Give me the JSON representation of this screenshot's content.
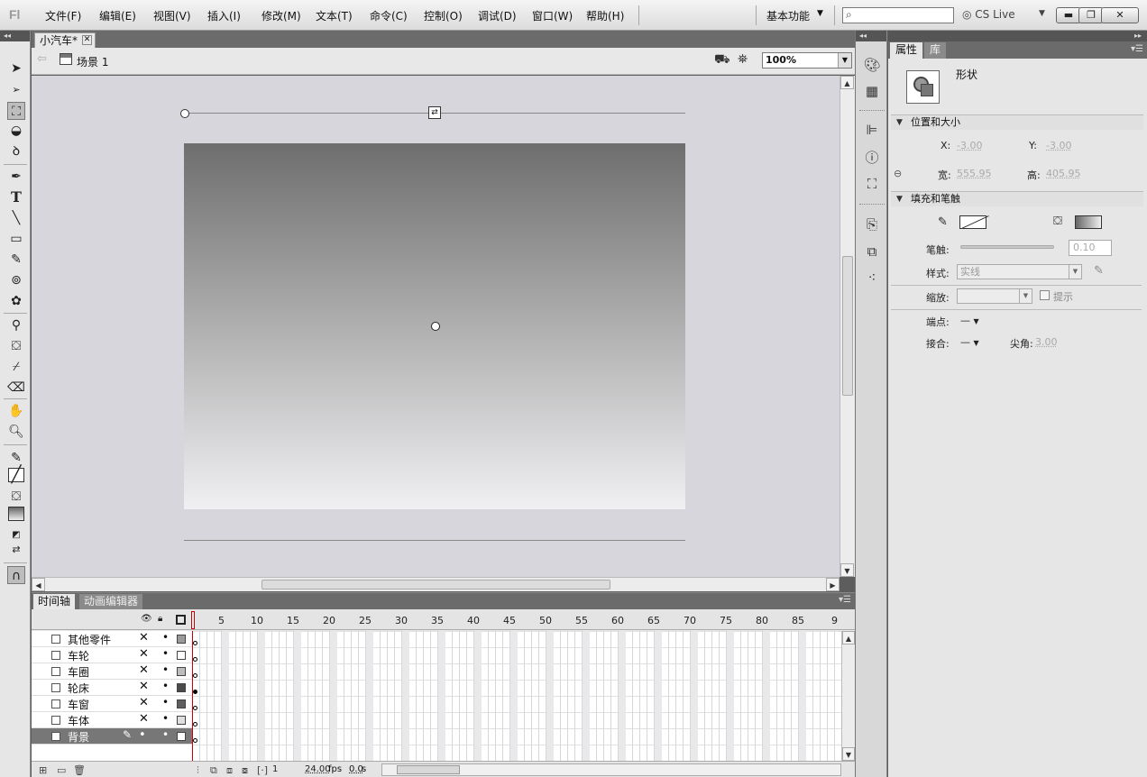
{
  "app": {
    "logo_text": "Fl"
  },
  "menu": [
    {
      "label": "文件(F)"
    },
    {
      "label": "编辑(E)"
    },
    {
      "label": "视图(V)"
    },
    {
      "label": "插入(I)"
    },
    {
      "label": "修改(M)"
    },
    {
      "label": "文本(T)"
    },
    {
      "label": "命令(C)"
    },
    {
      "label": "控制(O)"
    },
    {
      "label": "调试(D)"
    },
    {
      "label": "窗口(W)"
    },
    {
      "label": "帮助(H)"
    }
  ],
  "workspace": {
    "label": "基本功能",
    "arrow": "▼"
  },
  "search": {
    "icon": "⌕",
    "placeholder": ""
  },
  "cslive": {
    "label": "CS Live",
    "icon": "cs-live-icon"
  },
  "window_controls": {
    "minimize": "▬",
    "restore": "❐",
    "close": "✕"
  },
  "document": {
    "tab_label": "小汽车*",
    "close_glyph": "✕",
    "scene_label": "场景 1",
    "zoom": "100%"
  },
  "timeline": {
    "tabs": [
      "时间轴",
      "动画编辑器"
    ],
    "frame_numbers": [
      "5",
      "10",
      "15",
      "20",
      "25",
      "30",
      "35",
      "40",
      "45",
      "50",
      "55",
      "60",
      "65",
      "70",
      "75",
      "80",
      "85",
      "9"
    ],
    "layers": [
      {
        "name": "其他零件",
        "color": "#9a9a9a",
        "keyframe": "empty"
      },
      {
        "name": "车轮",
        "color": "#ffffff",
        "keyframe": "empty"
      },
      {
        "name": "车圈",
        "color": "#bdbdbd",
        "keyframe": "empty"
      },
      {
        "name": "轮床",
        "color": "#4a4a4a",
        "keyframe": "filled"
      },
      {
        "name": "车窗",
        "color": "#5e5e5e",
        "keyframe": "empty"
      },
      {
        "name": "车体",
        "color": "#e0e0e0",
        "keyframe": "empty"
      },
      {
        "name": "背景",
        "color": "#ffffff",
        "keyframe": "empty",
        "selected": true
      }
    ],
    "current_frame": "1",
    "fps": "24.00",
    "fps_unit": "fps",
    "time": "0.0",
    "time_unit": "s"
  },
  "properties": {
    "tabs": [
      "属性",
      "库"
    ],
    "object_type": "形状",
    "position_size": {
      "header": "位置和大小",
      "x_label": "X:",
      "x": "-3.00",
      "y_label": "Y:",
      "y": "-3.00",
      "w_label": "宽:",
      "w": "555.95",
      "h_label": "高:",
      "h": "405.95"
    },
    "fill_stroke": {
      "header": "填充和笔触",
      "stroke_label": "笔触:",
      "stroke_value": "0.10",
      "style_label": "样式:",
      "style_value": "实线",
      "scale_label": "缩放:",
      "scale_value": "",
      "hint_label": "提示",
      "cap_label": "端点:",
      "cap_value": "—",
      "join_label": "接合:",
      "join_value": "—",
      "miter_label": "尖角:",
      "miter_value": "3.00"
    }
  }
}
